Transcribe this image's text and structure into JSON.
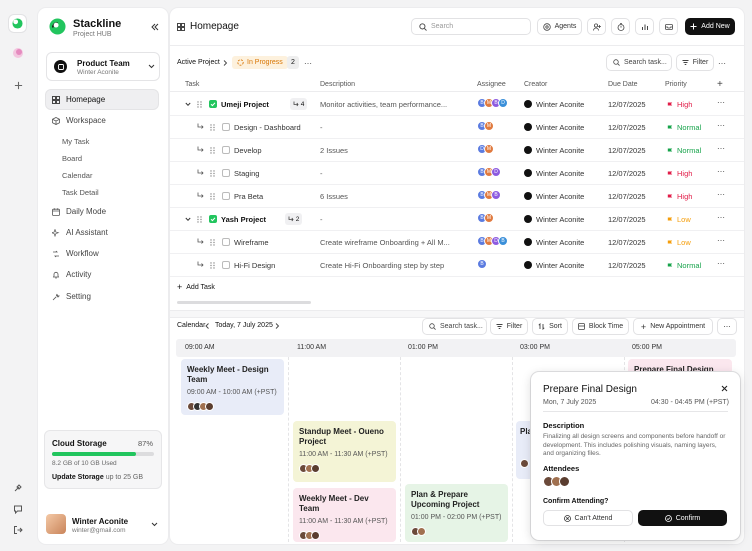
{
  "rail": {
    "icons": [
      "logo-icon",
      "circle-icon",
      "plus-icon",
      "tool-icon",
      "chat-icon",
      "logout-icon"
    ]
  },
  "brand": {
    "name": "Stackline",
    "subtitle": "Project HUB"
  },
  "team": {
    "name": "Product Team",
    "owner": "Winter Aconite"
  },
  "nav": {
    "homepage": "Homepage",
    "workspace": "Workspace",
    "workspace_items": [
      "My Task",
      "Board",
      "Calendar",
      "Task Detail"
    ],
    "daily_mode": "Daily Mode",
    "ai_assistant": "AI Assistant",
    "workflow": "Workflow",
    "activity": "Activity",
    "setting": "Setting"
  },
  "storage": {
    "title": "Cloud Storage",
    "percent_label": "87%",
    "fill_fraction": 0.82,
    "used": "8.2 GB of 10 GB Used",
    "update_label": "Update Storage",
    "update_suffix": "up to 25 GB"
  },
  "user": {
    "name": "Winter Aconite",
    "email": "winter@gmail.com"
  },
  "header": {
    "title": "Homepage",
    "search_placeholder": "Search",
    "agents_label": "Agents",
    "add_new_label": "Add New"
  },
  "project_bar": {
    "breadcrumb": "Active Project",
    "status": "In Progress",
    "count": "2",
    "search_placeholder": "Search task...",
    "filter_label": "Filter"
  },
  "table": {
    "headers": [
      "Task",
      "Description",
      "Assignee",
      "Creator",
      "Due Date",
      "Priority"
    ],
    "rows": [
      {
        "level": 0,
        "task": "Umeji Project",
        "subcount": "4",
        "description": "Monitor activities, team performance...",
        "assignees": [
          "B",
          "M",
          "B",
          "D"
        ],
        "creator": "Winter Aconite",
        "due": "12/07/2025",
        "priority": "High",
        "checked": true
      },
      {
        "level": 1,
        "task": "Design - Dashboard",
        "description": "-",
        "assignees": [
          "B",
          "M"
        ],
        "creator": "Winter Aconite",
        "due": "12/07/2025",
        "priority": "Normal",
        "checked": false
      },
      {
        "level": 1,
        "task": "Develop",
        "description": "2 Issues",
        "assignees": [
          "D",
          "M"
        ],
        "creator": "Winter Aconite",
        "due": "12/07/2025",
        "priority": "Normal",
        "checked": false
      },
      {
        "level": 1,
        "task": "Staging",
        "description": "-",
        "assignees": [
          "B",
          "M",
          "D"
        ],
        "creator": "Winter Aconite",
        "due": "12/07/2025",
        "priority": "High",
        "checked": false
      },
      {
        "level": 1,
        "task": "Pra Beta",
        "description": "6 Issues",
        "assignees": [
          "B",
          "M",
          "B"
        ],
        "creator": "Winter Aconite",
        "due": "12/07/2025",
        "priority": "High",
        "checked": false
      },
      {
        "level": 0,
        "task": "Yash Project",
        "subcount": "2",
        "description": "-",
        "assignees": [
          "B",
          "M"
        ],
        "creator": "Winter Aconite",
        "due": "12/07/2025",
        "priority": "Low",
        "checked": true
      },
      {
        "level": 1,
        "task": "Wireframe",
        "description": "Create wireframe Onboarding + All M...",
        "assignees": [
          "B",
          "M",
          "D",
          "B"
        ],
        "creator": "Winter Aconite",
        "due": "12/07/2025",
        "priority": "Low",
        "checked": false
      },
      {
        "level": 1,
        "task": "Hi-Fi Design",
        "description": "Create Hi-Fi Onboarding step by step",
        "assignees": [
          "B"
        ],
        "creator": "Winter Aconite",
        "due": "12/07/2025",
        "priority": "Normal",
        "checked": false
      }
    ],
    "add_task_label": "Add Task"
  },
  "calendar": {
    "label": "Calendar",
    "date": "Today, 7 July 2025",
    "search_placeholder": "Search task...",
    "filter_label": "Filter",
    "sort_label": "Sort",
    "block_time_label": "Block Time",
    "new_appointment_label": "New Appointment",
    "times": [
      "09:00 AM",
      "11:00 AM",
      "01:00 PM",
      "03:00 PM",
      "05:00 PM"
    ],
    "events": [
      {
        "title": "Weekly Meet - Design Team",
        "time": "09:00 AM - 10:00 AM (+PST)"
      },
      {
        "title": "Standup Meet - Oueno Project",
        "time": "11:00 AM - 11:30 AM (+PST)"
      },
      {
        "title": "Weekly Meet - Dev Team",
        "time": "11:00 AM - 11:30 AM (+PST)"
      },
      {
        "title": "Plan & Prepare Upcoming Project",
        "time": "01:00 PM - 02:00 PM (+PST)"
      },
      {
        "title": "Pla",
        "time": ""
      },
      {
        "title": "Prepare Final Design",
        "time": ""
      }
    ]
  },
  "popup": {
    "title": "Prepare Final Design",
    "date": "Mon, 7 July 2025",
    "time": "04:30 - 04:45 PM (+PST)",
    "description_heading": "Description",
    "description": "Finalizing all design screens and components before handoff or development. This includes polishing visuals, naming layers, and organizing files.",
    "attendees_heading": "Attendees",
    "confirm_question": "Confirm Attending?",
    "cant_attend_label": "Can't Attend",
    "confirm_label": "Confirm"
  },
  "colors": {
    "accent_green": "#22c55e",
    "high": "#e11d48",
    "normal": "#16a34a",
    "low": "#f59e0b",
    "ev_blue": "#e8ecf8",
    "ev_yellow": "#f4f4d6",
    "ev_pink": "#fbe7ee",
    "ev_green": "#e6f4e6"
  }
}
